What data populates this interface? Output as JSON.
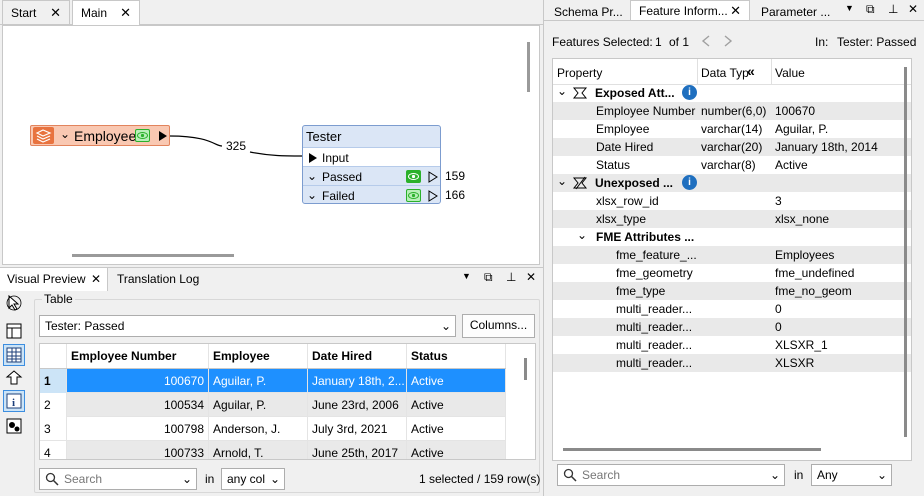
{
  "workspace_tabs": [
    {
      "label": "Start",
      "close": "✕"
    },
    {
      "label": "Main",
      "close": "✕"
    }
  ],
  "canvas": {
    "reader": {
      "label": "Employees"
    },
    "connection_count": "325",
    "tester": {
      "title": "Tester",
      "input_port": "Input",
      "ports": [
        {
          "label": "Passed",
          "count": "159"
        },
        {
          "label": "Failed",
          "count": "166"
        }
      ]
    }
  },
  "preview_tabs": {
    "visual_preview": "Visual Preview",
    "translation_log": "Translation Log"
  },
  "table_panel": {
    "group_label": "Table",
    "selected_table": "Tester: Passed",
    "columns_button": "Columns...",
    "headers": [
      "Employee Number",
      "Employee",
      "Date Hired",
      "Status"
    ],
    "rows": [
      {
        "index": "1",
        "number": "100670",
        "employee": "Aguilar, P.",
        "date": "January 18th, 2...",
        "status": "Active"
      },
      {
        "index": "2",
        "number": "100534",
        "employee": "Aguilar, P.",
        "date": "June 23rd, 2006",
        "status": "Active"
      },
      {
        "index": "3",
        "number": "100798",
        "employee": "Anderson, J.",
        "date": "July 3rd, 2021",
        "status": "Active"
      },
      {
        "index": "4",
        "number": "100733",
        "employee": "Arnold, T.",
        "date": "June 25th, 2017",
        "status": "Active"
      }
    ],
    "search_placeholder": "Search",
    "in_label": "in",
    "column_filter": "any col",
    "status": "1 selected / 159 row(s)"
  },
  "right_tabs": [
    {
      "label": "Schema Pr..."
    },
    {
      "label": "Feature Inform...",
      "close": "✕"
    },
    {
      "label": "Parameter ..."
    }
  ],
  "feature_info": {
    "features_selected_label": "Features Selected:",
    "current": "1",
    "of_label": "of 1",
    "in_label": "In:",
    "in_value": "Tester: Passed",
    "headers": {
      "property": "Property",
      "data_type": "Data Typ",
      "value": "Value"
    },
    "exposed_group": "Exposed Att...",
    "exposed": [
      {
        "property": "Employee Number",
        "type": "number(6,0)",
        "value": "100670"
      },
      {
        "property": "Employee",
        "type": "varchar(14)",
        "value": "Aguilar, P."
      },
      {
        "property": "Date Hired",
        "type": "varchar(20)",
        "value": "January 18th, 2014"
      },
      {
        "property": "Status",
        "type": "varchar(8)",
        "value": "Active"
      }
    ],
    "unexposed_group": "Unexposed ...",
    "unexposed": [
      {
        "property": "xlsx_row_id",
        "value": "3"
      },
      {
        "property": "xlsx_type",
        "value": "xlsx_none"
      }
    ],
    "fme_group": "FME Attributes ...",
    "fme": [
      {
        "property": "fme_feature_...",
        "value": "Employees"
      },
      {
        "property": "fme_geometry",
        "value": "fme_undefined"
      },
      {
        "property": "fme_type",
        "value": "fme_no_geom"
      },
      {
        "property": "multi_reader...",
        "value": "0"
      },
      {
        "property": "multi_reader...",
        "value": "0"
      },
      {
        "property": "multi_reader...",
        "value": "XLSXR_1"
      },
      {
        "property": "multi_reader...",
        "value": "XLSXR"
      }
    ],
    "search_placeholder": "Search",
    "filter_in_label": "in",
    "filter_value": "Any"
  },
  "colors": {
    "selection": "#1e90ff",
    "reader_fill": "#f9c8b2",
    "reader_border": "#e2845d",
    "tester_fill": "#dbe6f6",
    "tester_border": "#7c9ccf",
    "info_blue": "#1f6fbf",
    "eye_green": "#2bb12b"
  }
}
